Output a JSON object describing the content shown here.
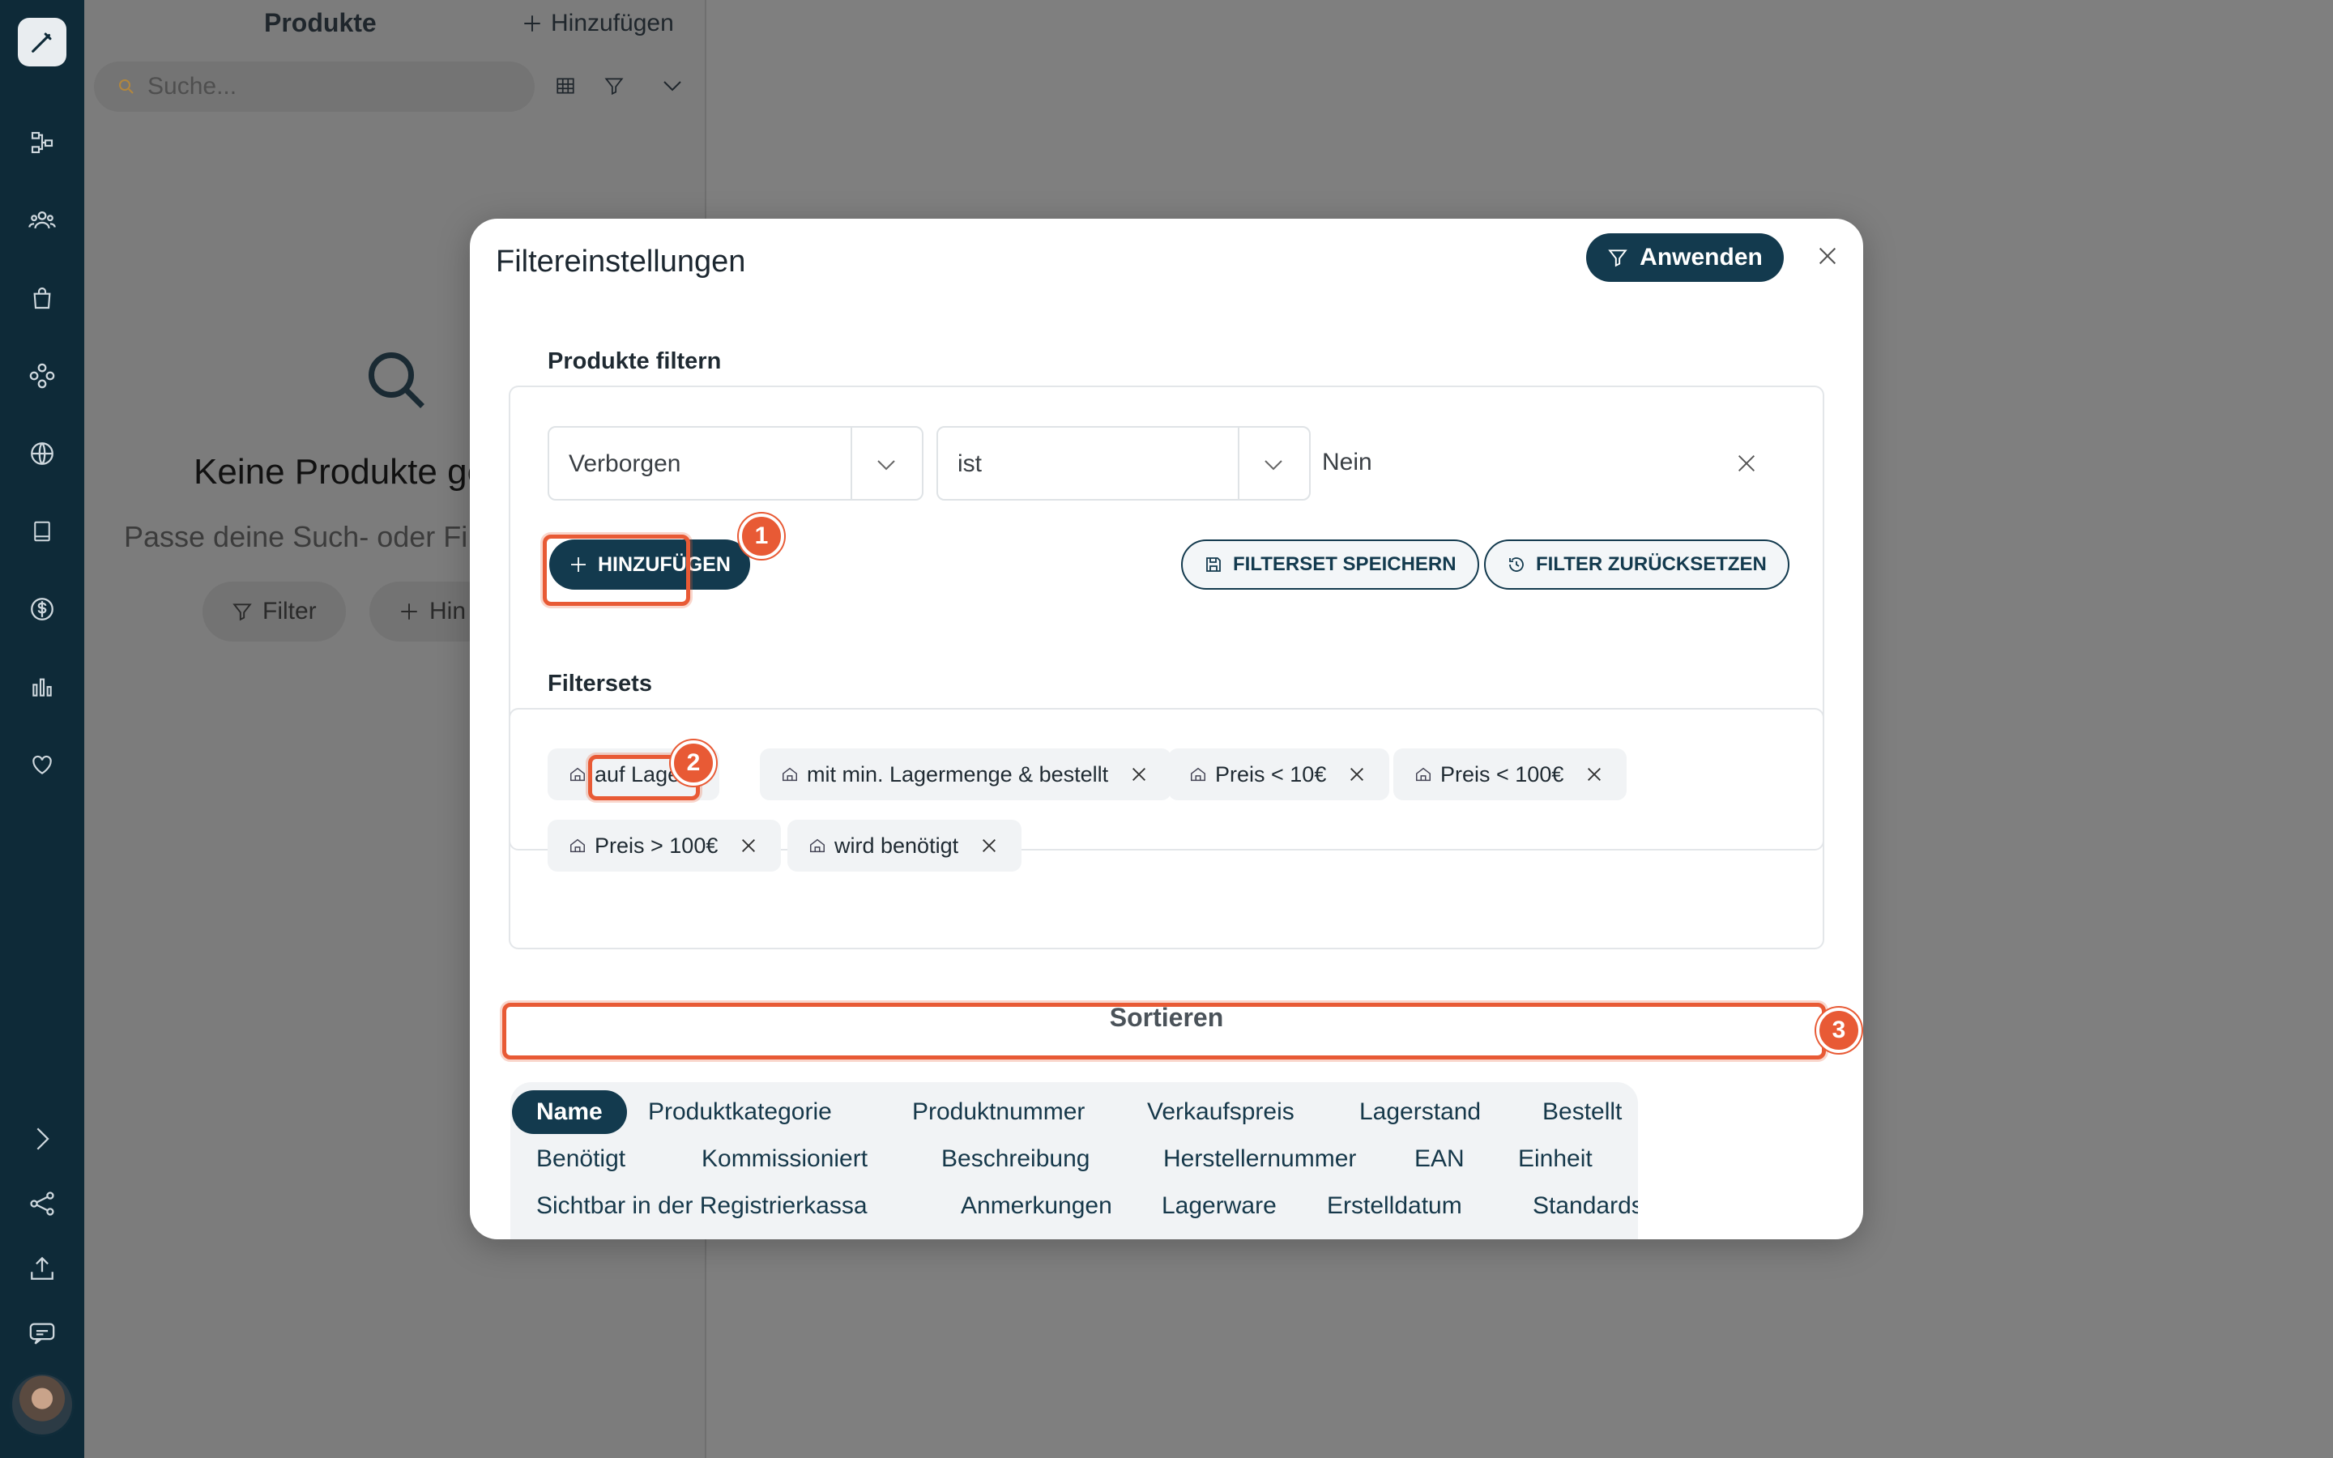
{
  "sidebar": {
    "icons": [
      "logo-brush-icon",
      "flow-icon",
      "users-icon",
      "bag-icon",
      "modules-icon",
      "globe-icon",
      "book-icon",
      "dollar-icon",
      "chart-icon",
      "heart-icon",
      "chevron-right-icon",
      "share-icon",
      "upload-icon",
      "chat-icon",
      "avatar"
    ]
  },
  "products_panel": {
    "title": "Produkte",
    "add_label": "Hinzufügen",
    "search_placeholder": "Suche...",
    "empty_title": "Keine Produkte ge",
    "empty_subtitle": "Passe deine Such- oder Fi",
    "filter_button": "Filter",
    "add_button_partial": "Hin"
  },
  "modal": {
    "title": "Filtereinstellungen",
    "apply_label": "Anwenden",
    "filter_section": {
      "label": "Produkte filtern",
      "field": "Verborgen",
      "operator": "ist",
      "value": "Nein",
      "add_label": "HINZUFÜGEN",
      "save_label": "FILTERSET SPEICHERN",
      "reset_label": "FILTER ZURÜCKSETZEN"
    },
    "filtersets": {
      "label": "Filtersets",
      "items": [
        "auf Lager",
        "mit min. Lagermenge & bestellt",
        "Preis < 10€",
        "Preis < 100€",
        "Preis > 100€",
        "wird benötigt"
      ]
    },
    "sort": {
      "label": "Sortieren",
      "options": [
        "Name",
        "Produktkategorie",
        "Produktnummer",
        "Verkaufspreis",
        "Lagerstand",
        "Bestellt",
        "Benötigt",
        "Kommissioniert",
        "Beschreibung",
        "Herstellernummer",
        "EAN",
        "Einheit",
        "Sichtbar in der Registrierkassa",
        "Anmerkungen",
        "Lagerware",
        "Erstelldatum",
        "Standardsteuer"
      ],
      "active": "Name"
    }
  },
  "annotations": [
    "1",
    "2",
    "3"
  ],
  "colors": {
    "primary": "#133a4e",
    "annotation": "#e85a35",
    "sidebar": "#0e2a38"
  }
}
